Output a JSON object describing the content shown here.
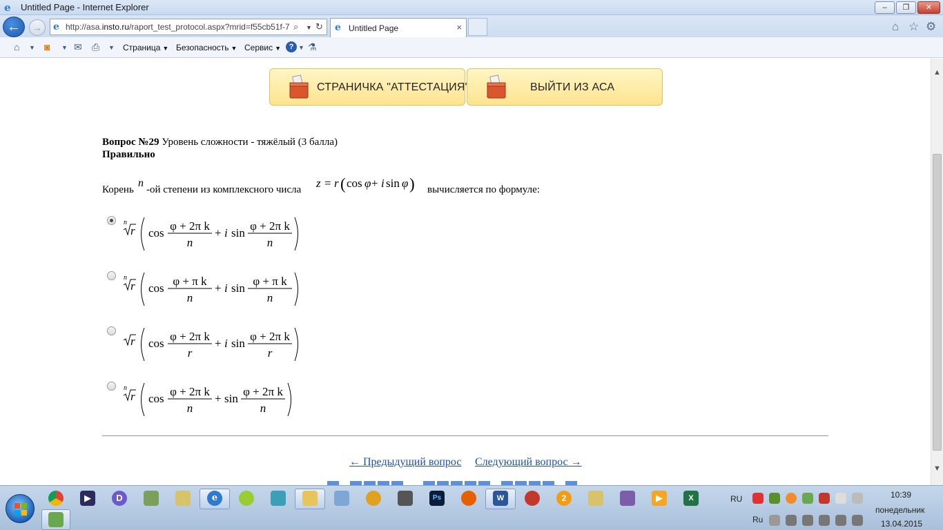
{
  "window": {
    "title": "Untitled Page - Internet Explorer",
    "minimize": "–",
    "maximize": "❐",
    "close": "✕"
  },
  "browser": {
    "url_prefix": "http://asa.",
    "url_domain": "insto.ru",
    "url_path": "/raport_test_protocol.aspx?mrid=f55cb51f-7",
    "tab_title": "Untitled Page",
    "tab_close": "×"
  },
  "command_bar": {
    "page_menu": "Страница",
    "safety_menu": "Безопасность",
    "tools_menu": "Сервис",
    "help_icon": "?"
  },
  "page": {
    "button_attestation": "СТРАНИЧКА \"АТТЕСТАЦИЯ\"",
    "button_exit": "ВЫЙТИ ИЗ АСА",
    "question_number": "Вопрос №29",
    "question_level": "Уровень сложности - тяжёлый (3 балла)",
    "result": "Правильно",
    "question_text_1": "Корень",
    "question_var_n": "n",
    "question_text_2": "-ой степени из комплексного числа",
    "question_text_3": "вычисляется по формуле:",
    "selected_option": 1,
    "prev_link": "← Предыдущий вопрос",
    "next_link": "Следующий вопрос →"
  },
  "options": [
    {
      "root_index": "n",
      "numerator": "φ + 2π k",
      "denominator": "n",
      "has_i": true
    },
    {
      "root_index": "n",
      "numerator": "φ + π k",
      "denominator": "n",
      "has_i": true
    },
    {
      "root_index": "",
      "numerator": "φ + 2π k",
      "denominator": "r",
      "has_i": true
    },
    {
      "root_index": "n",
      "numerator": "φ + 2π k",
      "denominator": "n",
      "has_i": false
    }
  ],
  "taskbar": {
    "lang_top": "RU",
    "lang_bottom": "Ru",
    "time": "10:39",
    "weekday": "понедельник",
    "date": "13.04.2015"
  },
  "colors": {
    "link": "#1a4fb5",
    "button_yellow": "#fde38f",
    "ie_blue": "#2f7ad0"
  }
}
